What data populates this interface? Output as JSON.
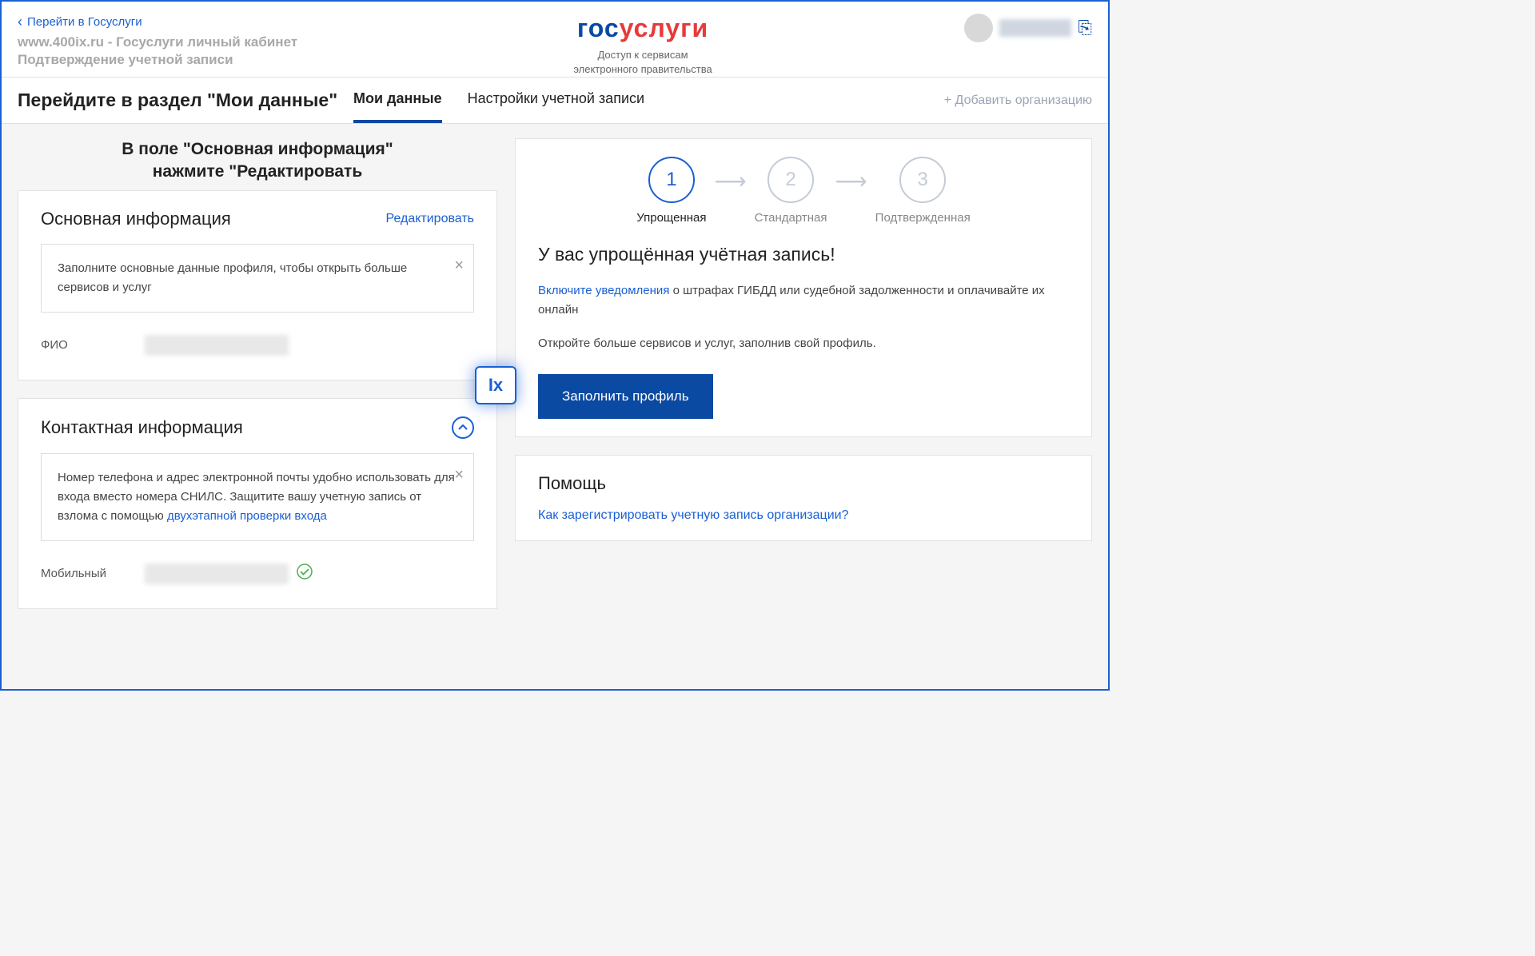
{
  "header": {
    "back_link": "Перейти в Госуслуги",
    "watermark_line1": "www.400ix.ru - Госуслуги личный кабинет",
    "watermark_line2": "Подтверждение учетной записи",
    "logo_part1": "гос",
    "logo_part2": "услуги",
    "sublogo_line1": "Доступ к сервисам",
    "sublogo_line2": "электронного правительства"
  },
  "tabs": {
    "instruction": "Перейдите в раздел \"Мои данные\"",
    "tab1": "Мои данные",
    "tab2": "Настройки учетной записи",
    "add_org": "+ Добавить организацию"
  },
  "main_info": {
    "instruction_line1": "В поле \"Основная информация\"",
    "instruction_line2": "нажмите \"Редактировать",
    "title": "Основная информация",
    "edit": "Редактировать",
    "hint": "Заполните основные данные профиля, чтобы открыть больше сервисов и услуг",
    "fio_label": "ФИО",
    "badge": "Ix"
  },
  "contact_info": {
    "title": "Контактная информация",
    "hint_part1": "Номер телефона и адрес электронной почты удобно использовать для входа вместо номера СНИЛС. Защитите вашу учетную запись от взлома с помощью ",
    "hint_link": "двухэтапной проверки входа",
    "mobile_label": "Мобильный"
  },
  "account_status": {
    "steps": [
      {
        "num": "1",
        "label": "Упрощенная"
      },
      {
        "num": "2",
        "label": "Стандартная"
      },
      {
        "num": "3",
        "label": "Подтвержденная"
      }
    ],
    "title": "У вас упрощённая учётная запись!",
    "notif_link": "Включите уведомления",
    "notif_text": " о штрафах ГИБДД или судебной задолженности и оплачивайте их онлайн",
    "more_text": "Откройте больше сервисов и услуг, заполнив свой профиль.",
    "button": "Заполнить профиль"
  },
  "help": {
    "title": "Помощь",
    "link1": "Как зарегистрировать учетную запись организации?"
  }
}
